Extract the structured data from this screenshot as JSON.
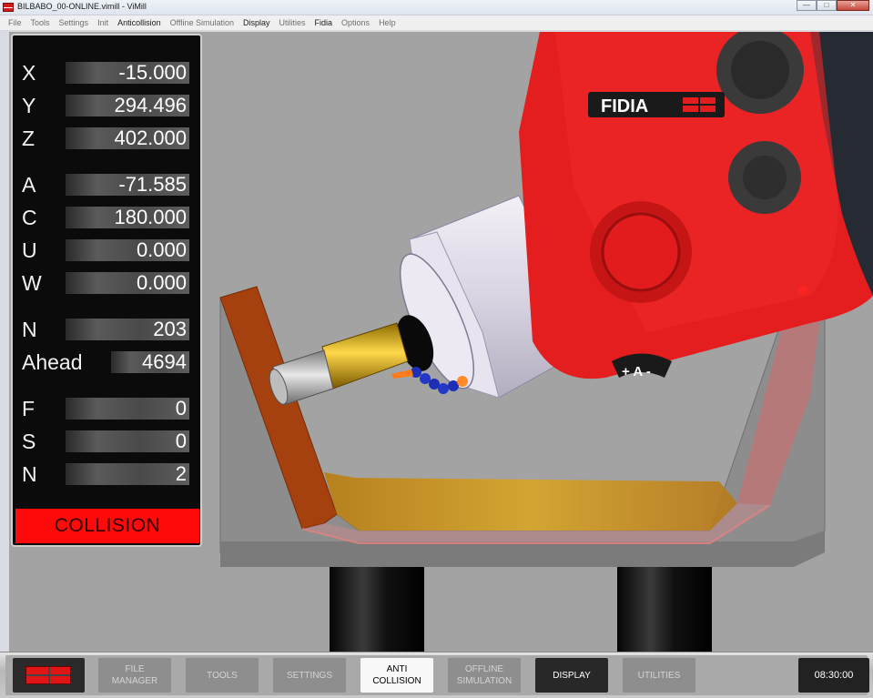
{
  "window": {
    "title": "BILBABO_00-ONLINE.vimill - ViMill",
    "minimize": "—",
    "maximize": "□",
    "close": "✕"
  },
  "menu": [
    {
      "label": "File",
      "emphasis": false
    },
    {
      "label": "Tools",
      "emphasis": false
    },
    {
      "label": "Settings",
      "emphasis": false
    },
    {
      "label": "Init",
      "emphasis": false
    },
    {
      "label": "Anticollision",
      "emphasis": true
    },
    {
      "label": "Offline Simulation",
      "emphasis": false
    },
    {
      "label": "Display",
      "emphasis": true
    },
    {
      "label": "Utilities",
      "emphasis": false
    },
    {
      "label": "Fidia",
      "emphasis": true
    },
    {
      "label": "Options",
      "emphasis": false
    },
    {
      "label": "Help",
      "emphasis": false
    }
  ],
  "dro": {
    "axes": [
      {
        "label": "X",
        "value": "-15.000"
      },
      {
        "label": "Y",
        "value": "294.496"
      },
      {
        "label": "Z",
        "value": "402.000"
      },
      {
        "label": "A",
        "value": "-71.585"
      },
      {
        "label": "C",
        "value": "180.000"
      },
      {
        "label": "U",
        "value": "0.000"
      },
      {
        "label": "W",
        "value": "0.000"
      }
    ],
    "program": [
      {
        "label": "N",
        "value": "203"
      },
      {
        "label": "Ahead",
        "value": "4694"
      }
    ],
    "feed": [
      {
        "label": "F",
        "value": "0"
      },
      {
        "label": "S",
        "value": "0"
      },
      {
        "label": "N",
        "value": "2"
      }
    ],
    "status": "COLLISION",
    "status_color": "#ff0a0a"
  },
  "scene": {
    "head_brand": "FIDIA",
    "axis_badge": "+ A -",
    "head_color": "#e41e1e",
    "background_color": "#a3a3a3"
  },
  "toolbar": {
    "buttons": [
      {
        "line1": "FILE",
        "line2": "MANAGER",
        "state": "normal"
      },
      {
        "line1": "TOOLS",
        "line2": "",
        "state": "normal"
      },
      {
        "line1": "SETTINGS",
        "line2": "",
        "state": "normal"
      },
      {
        "line1": "ANTI",
        "line2": "COLLISION",
        "state": "active"
      },
      {
        "line1": "OFFLINE",
        "line2": "SIMULATION",
        "state": "normal"
      },
      {
        "line1": "DISPLAY",
        "line2": "",
        "state": "dark"
      },
      {
        "line1": "UTILITIES",
        "line2": "",
        "state": "normal"
      }
    ],
    "clock": "08:30:00"
  }
}
